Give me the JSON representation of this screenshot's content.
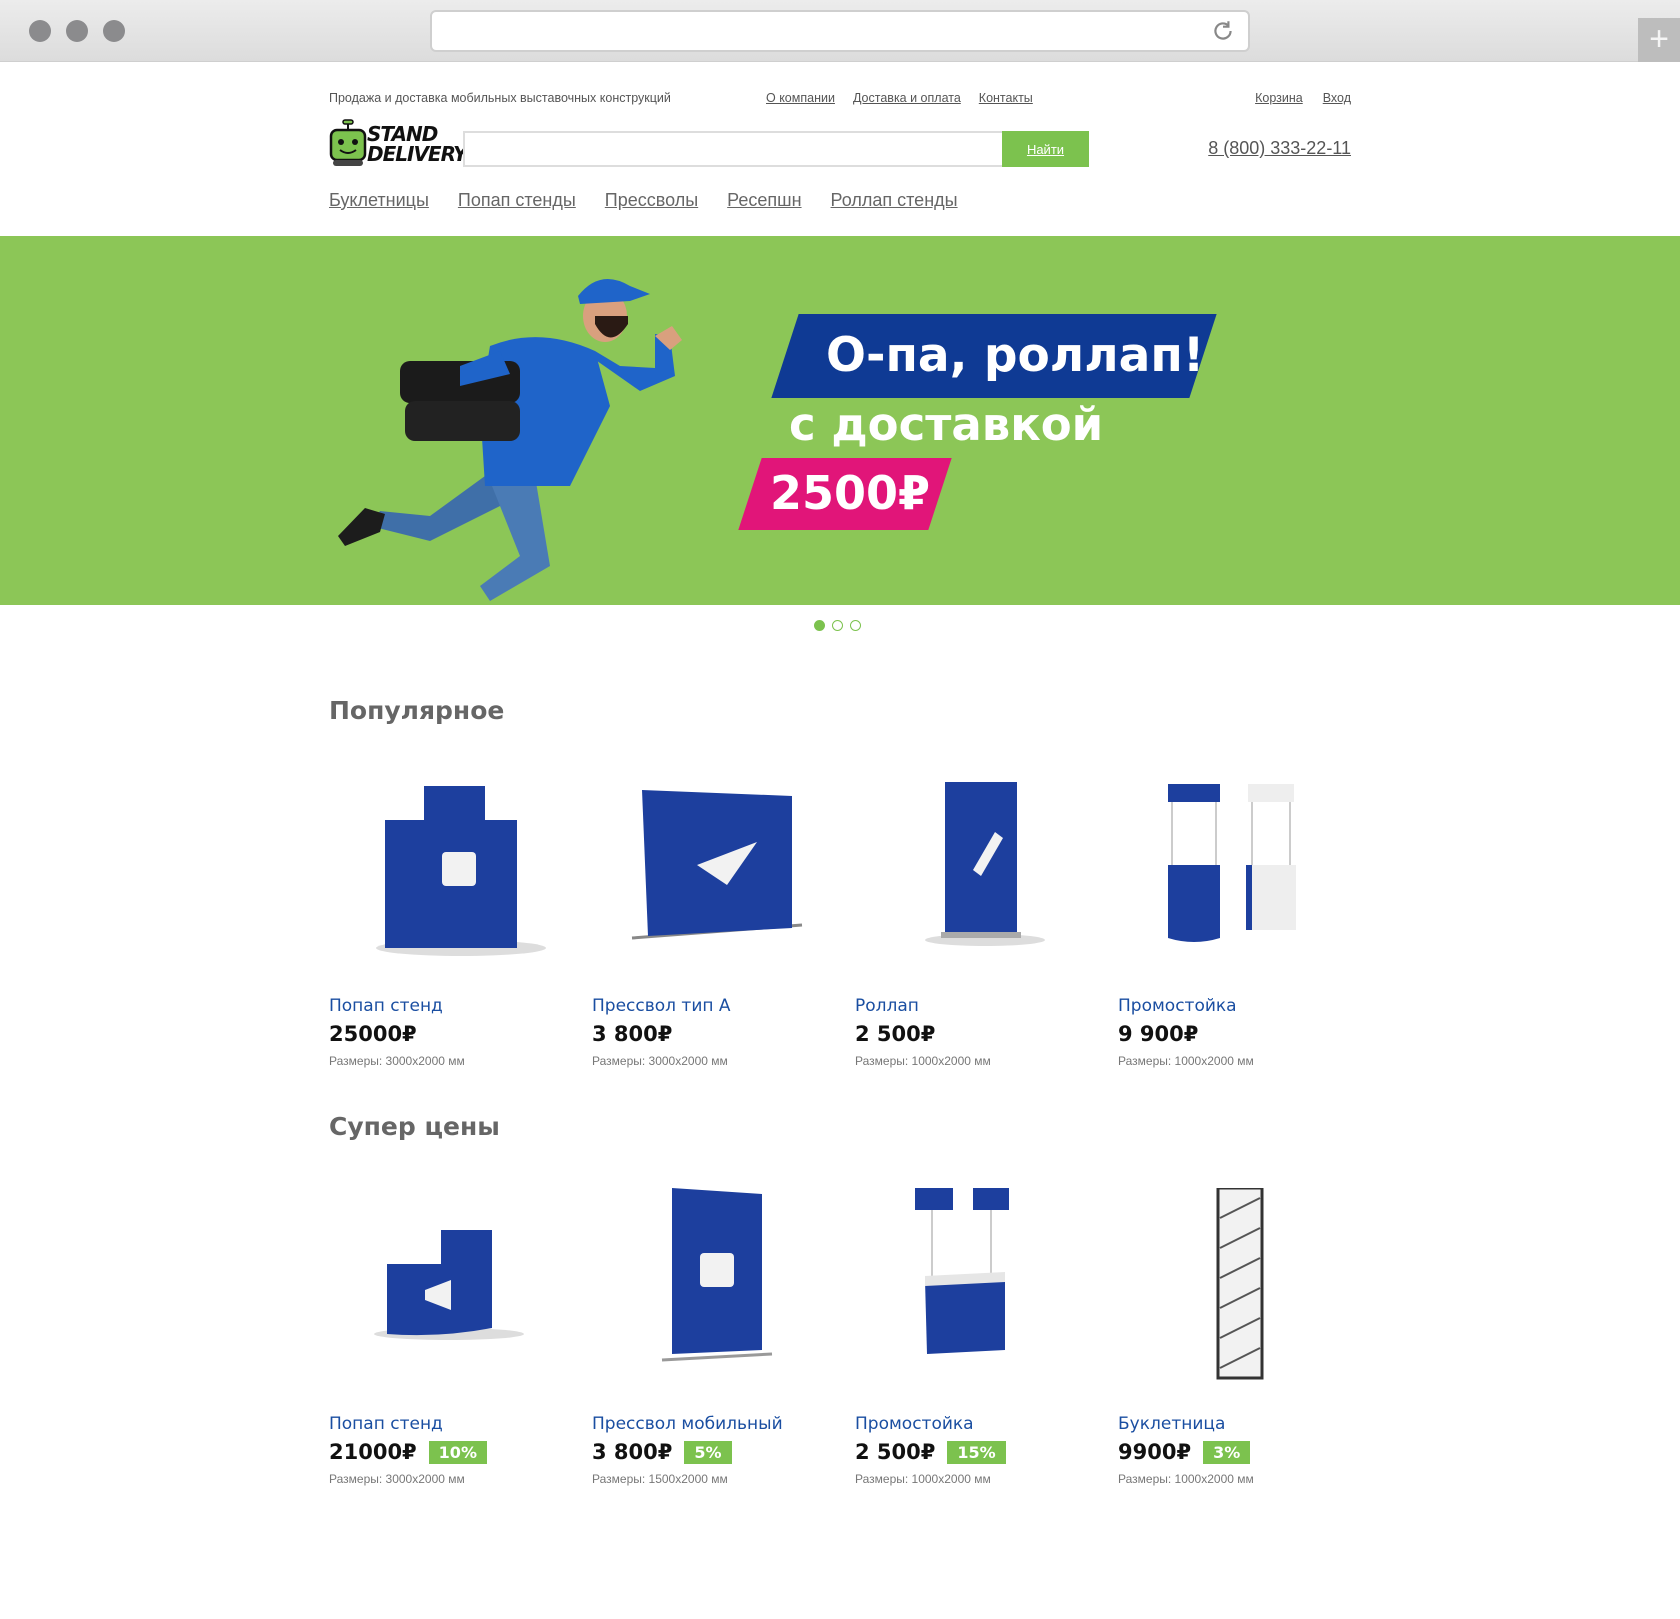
{
  "header": {
    "tagline": "Продажа и доставка мобильных выставочных конструкций",
    "top_links": [
      "О компании",
      "Доставка и оплата",
      "Контакты"
    ],
    "user_links": [
      "Корзина",
      "Вход"
    ],
    "logo_text_1": "STAND",
    "logo_text_2": "DELIVERY",
    "search_button": "Найти",
    "search_placeholder": "",
    "phone": "8 (800) 333-22-11",
    "categories": [
      "Буклетницы",
      "Попап стенды",
      "Прессволы",
      "Ресепшн",
      "Роллап стенды"
    ]
  },
  "hero": {
    "headline": "О-па, роллап!",
    "subline": "с доставкой",
    "price": "2500₽",
    "slides": 3,
    "active_slide": 1
  },
  "popular": {
    "title": "Популярное",
    "items": [
      {
        "name": "Попап стенд",
        "price": "25000₽",
        "dims": "Размеры: 3000х2000 мм",
        "icon": "cube-icon"
      },
      {
        "name": "Прессвол тип А",
        "price": "3 800₽",
        "dims": "Размеры: 3000х2000 мм",
        "icon": "paper-plane-icon"
      },
      {
        "name": "Роллап",
        "price": "2 500₽",
        "dims": "Размеры: 1000х2000 мм",
        "icon": "pencil-icon"
      },
      {
        "name": "Промостойка",
        "price": "9 900₽",
        "dims": "Размеры: 1000х2000 мм",
        "icon": "promo-counter-icon"
      }
    ]
  },
  "super": {
    "title": "Супер цены",
    "items": [
      {
        "name": "Попап стенд",
        "price": "21000₽",
        "discount": "10%",
        "dims": "Размеры: 3000х2000 мм",
        "icon": "megaphone-icon"
      },
      {
        "name": "Прессвол мобильный",
        "price": "3 800₽",
        "discount": "5%",
        "dims": "Размеры: 1500х2000 мм",
        "icon": "cube-icon"
      },
      {
        "name": "Промостойка",
        "price": "2 500₽",
        "discount": "15%",
        "dims": "Размеры: 1000х2000 мм",
        "icon": "promo-counter-icon"
      },
      {
        "name": "Буклетница",
        "price": "9900₽",
        "discount": "3%",
        "dims": "Размеры: 1000х2000 мм",
        "icon": "brochure-stand-icon"
      }
    ]
  },
  "colors": {
    "brand_green": "#7cc24e",
    "hero_green": "#8cc657",
    "brand_blue": "#0f3a94",
    "accent_pink": "#e11579",
    "link_blue": "#1a4ea1"
  }
}
